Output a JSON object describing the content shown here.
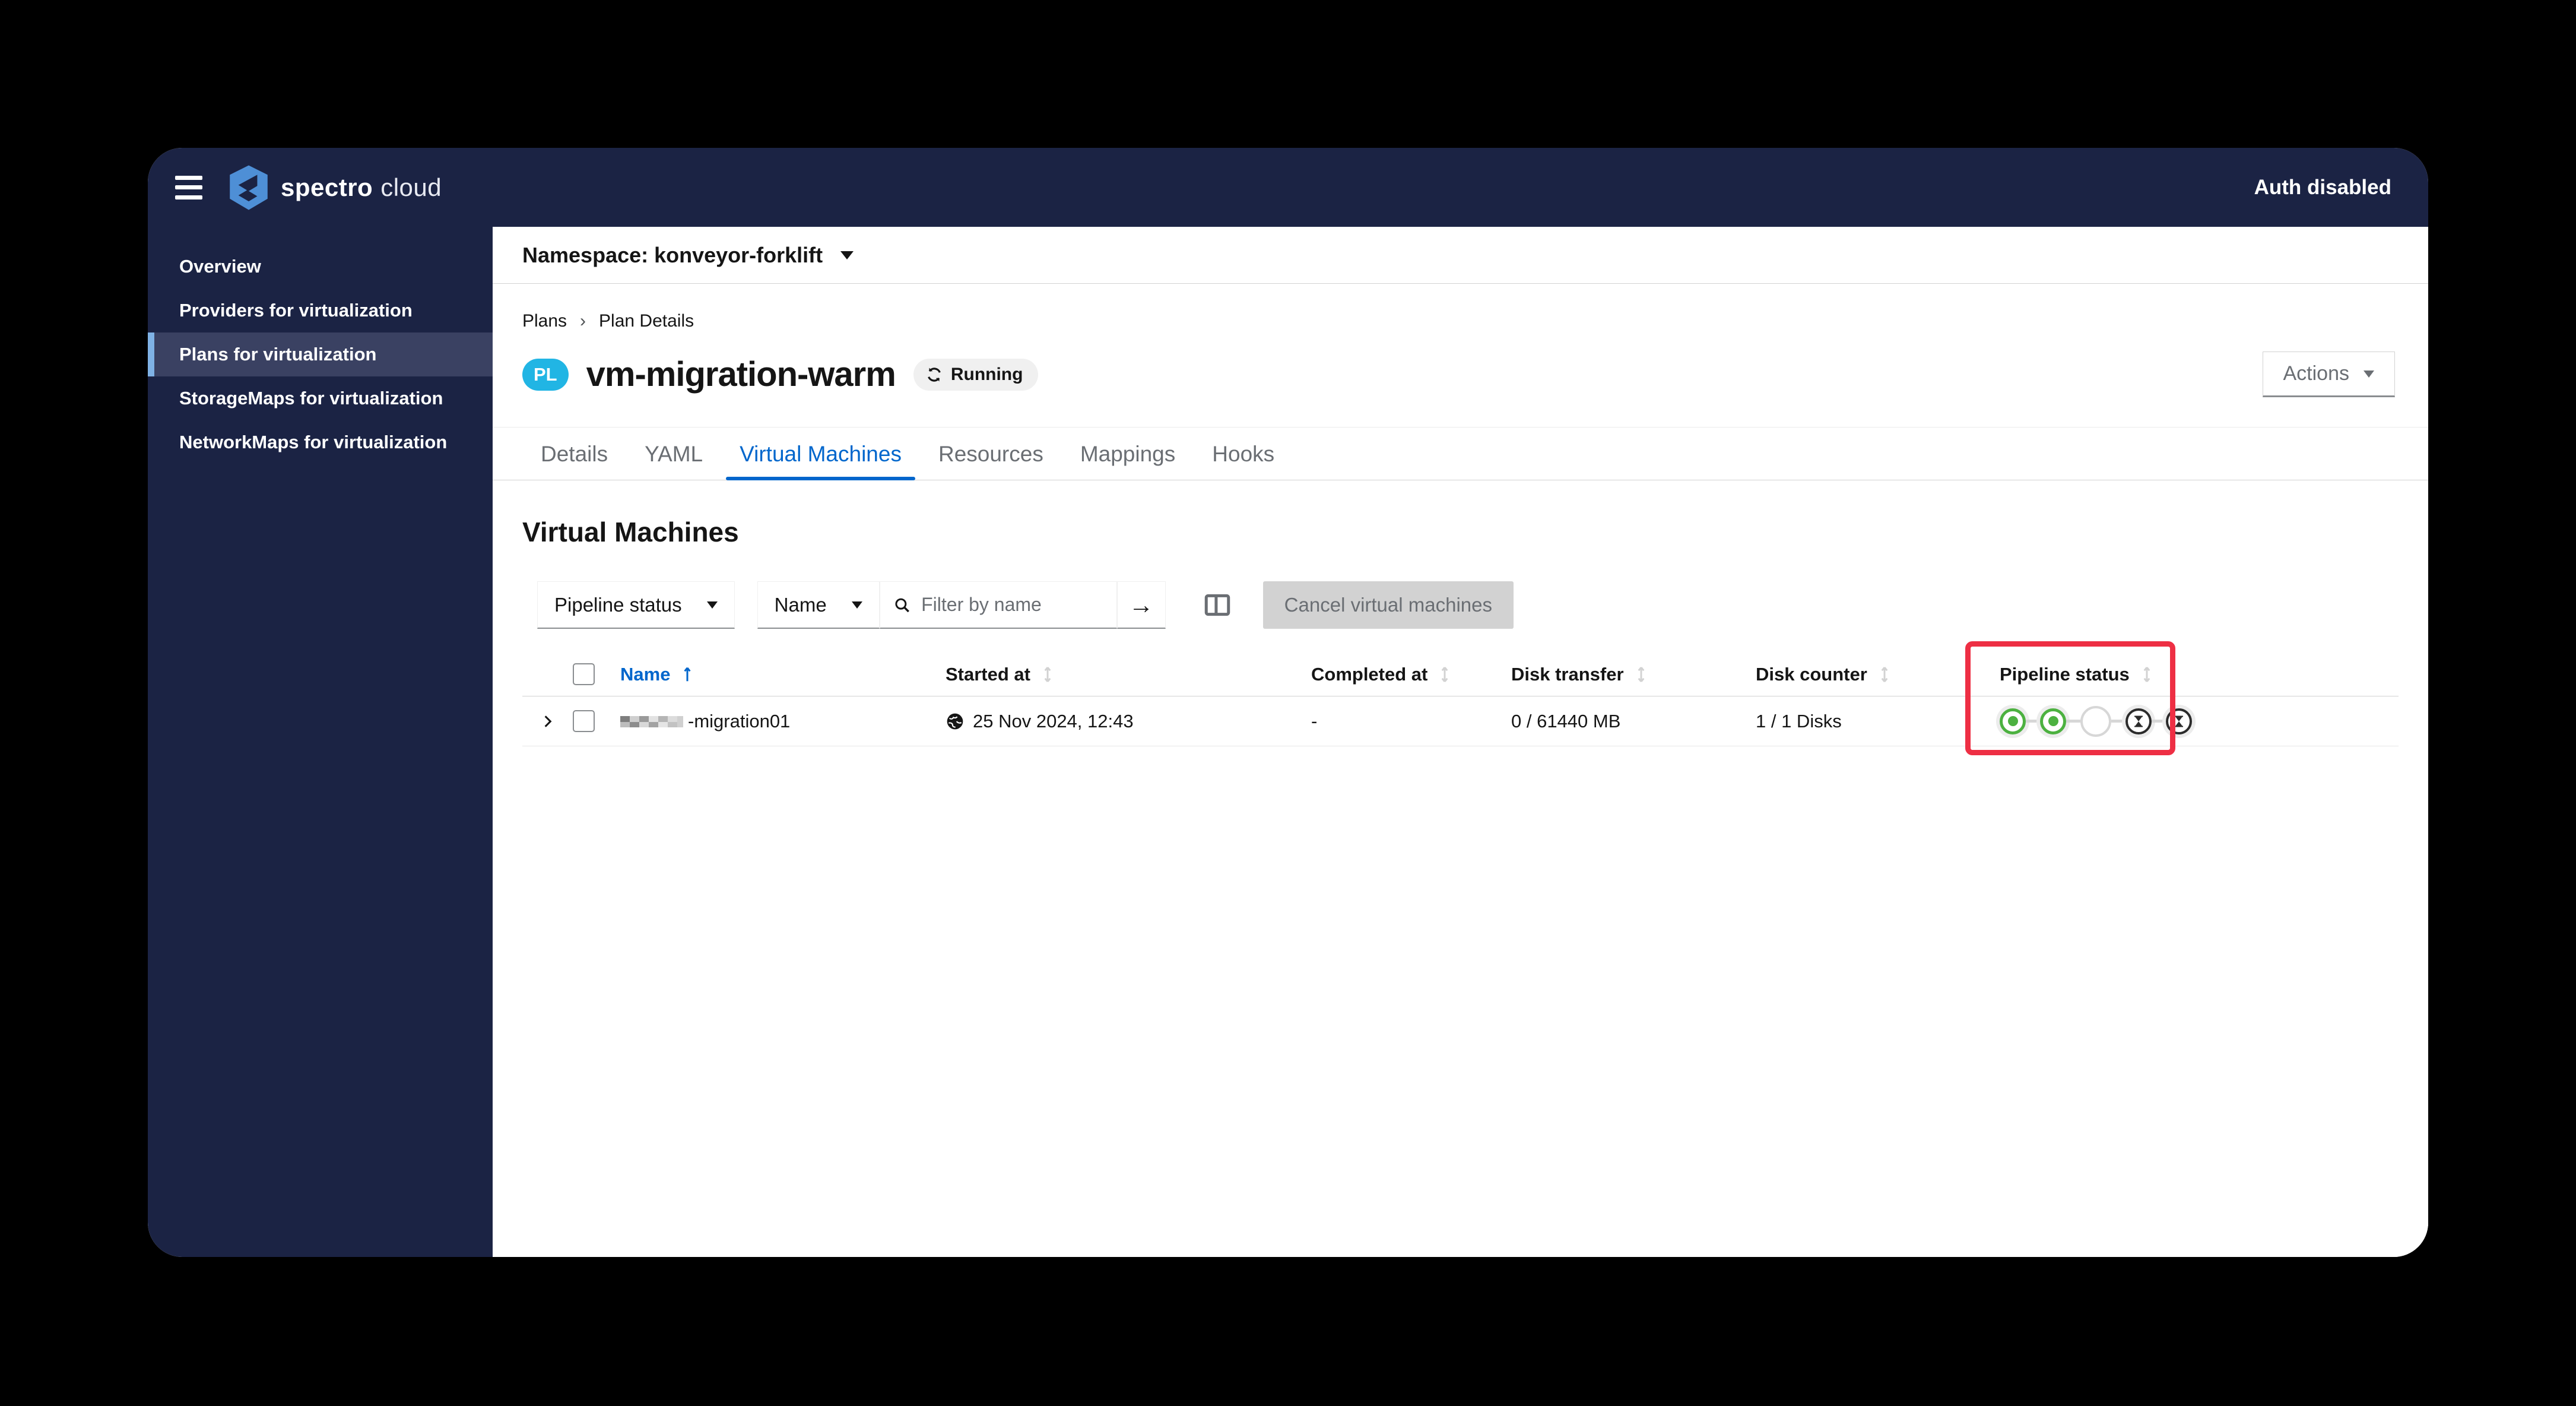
{
  "header": {
    "brand_primary": "spectro",
    "brand_secondary": "cloud",
    "auth_label": "Auth disabled"
  },
  "sidebar": {
    "items": [
      {
        "label": "Overview",
        "active": false
      },
      {
        "label": "Providers for virtualization",
        "active": false
      },
      {
        "label": "Plans for virtualization",
        "active": true
      },
      {
        "label": "StorageMaps for virtualization",
        "active": false
      },
      {
        "label": "NetworkMaps for virtualization",
        "active": false
      }
    ]
  },
  "namespace_bar": {
    "label": "Namespace: konveyor-forklift"
  },
  "breadcrumb": {
    "items": [
      "Plans",
      "Plan Details"
    ],
    "separator": "›"
  },
  "plan": {
    "badge": "PL",
    "title": "vm-migration-warm",
    "status_label": "Running",
    "actions_label": "Actions"
  },
  "tabs": {
    "items": [
      {
        "label": "Details",
        "active": false
      },
      {
        "label": "YAML",
        "active": false
      },
      {
        "label": "Virtual Machines",
        "active": true
      },
      {
        "label": "Resources",
        "active": false
      },
      {
        "label": "Mappings",
        "active": false
      },
      {
        "label": "Hooks",
        "active": false
      }
    ]
  },
  "section": {
    "title": "Virtual Machines"
  },
  "toolbar": {
    "pipeline_filter_label": "Pipeline status",
    "attr_filter_label": "Name",
    "search_placeholder": "Filter by name",
    "submit_arrow": "→",
    "cancel_button_label": "Cancel virtual machines",
    "cancel_disabled": true
  },
  "table": {
    "headers": {
      "name": "Name",
      "started": "Started at",
      "completed": "Completed at",
      "disk_transfer": "Disk transfer",
      "disk_counter": "Disk counter",
      "pipeline": "Pipeline status"
    },
    "sorted_by": "Name",
    "sort_direction": "ascending",
    "rows": [
      {
        "name_redacted_prefix": true,
        "name": "-migration01",
        "started_at": "25 Nov 2024, 12:43",
        "completed_at": "-",
        "disk_transfer": "0 / 61440 MB",
        "disk_counter": "1 / 1 Disks",
        "pipeline_steps": [
          "completed",
          "completed",
          "empty",
          "pending",
          "pending"
        ]
      }
    ]
  },
  "annotation": {
    "highlighted_column": "Pipeline status",
    "highlight_color": "#ee2f44"
  },
  "colors": {
    "brand_navy": "#1b2344",
    "sidebar_active": "#3a4162",
    "sidebar_accent": "#7fb2e5",
    "accent_blue": "#0066cc",
    "badge_cyan": "#21b5e4",
    "success_green": "#4cb140",
    "highlight_red": "#ee2f44",
    "disabled_gray": "#d2d2d2"
  }
}
